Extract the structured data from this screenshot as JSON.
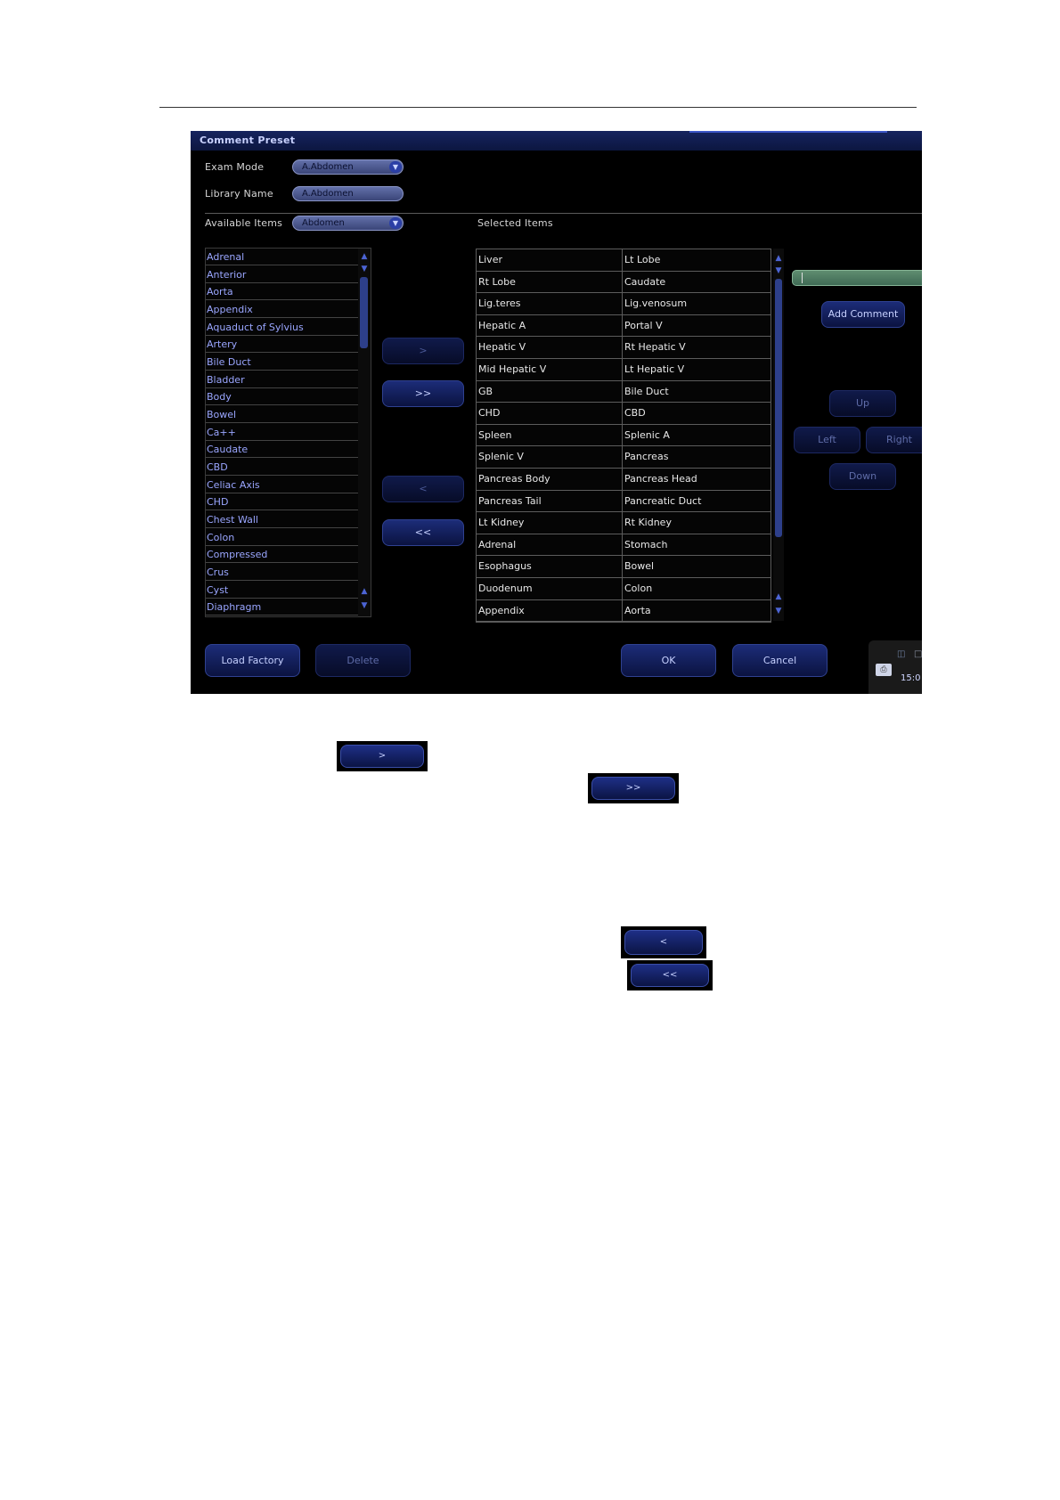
{
  "window": {
    "title": "Comment Preset"
  },
  "exam_mode": {
    "label": "Exam Mode",
    "value": "A.Abdomen"
  },
  "library_name": {
    "label": "Library Name",
    "value": "A.Abdomen"
  },
  "available": {
    "label": "Available Items",
    "filter": "Abdomen",
    "items": [
      "Adrenal",
      "Anterior",
      "Aorta",
      "Appendix",
      "Aquaduct of Sylvius",
      "Artery",
      "Bile Duct",
      "Bladder",
      "Body",
      "Bowel",
      "Ca++",
      "Caudate",
      "CBD",
      "Celiac Axis",
      "CHD",
      "Chest Wall",
      "Colon",
      "Compressed",
      "Crus",
      "Cyst",
      "Diaphragm"
    ]
  },
  "selected": {
    "label": "Selected Items",
    "rows": [
      [
        "Liver",
        "Lt Lobe"
      ],
      [
        "Rt Lobe",
        "Caudate"
      ],
      [
        "Lig.teres",
        "Lig.venosum"
      ],
      [
        "Hepatic A",
        "Portal V"
      ],
      [
        "Hepatic V",
        "Rt Hepatic V"
      ],
      [
        "Mid Hepatic V",
        "Lt Hepatic V"
      ],
      [
        "GB",
        "Bile Duct"
      ],
      [
        "CHD",
        "CBD"
      ],
      [
        "Spleen",
        "Splenic A"
      ],
      [
        "Splenic V",
        "Pancreas"
      ],
      [
        "Pancreas Body",
        "Pancreas Head"
      ],
      [
        "Pancreas Tail",
        "Pancreatic Duct"
      ],
      [
        "Lt Kidney",
        "Rt Kidney"
      ],
      [
        "Adrenal",
        "Stomach"
      ],
      [
        "Esophagus",
        "Bowel"
      ],
      [
        "Duodenum",
        "Colon"
      ],
      [
        "Appendix",
        "Aorta"
      ]
    ]
  },
  "transfer": {
    "add_one": ">",
    "add_all": ">>",
    "remove_one": "<",
    "remove_all": "<<"
  },
  "comment": {
    "add_label": "Add  Comment",
    "value": ""
  },
  "move": {
    "up": "Up",
    "left": "Left",
    "right": "Right",
    "down": "Down"
  },
  "footer": {
    "load_factory": "Load Factory",
    "delete": "Delete",
    "ok": "OK",
    "cancel": "Cancel"
  },
  "status": {
    "time": "15:0"
  },
  "icons": {
    "scroll_up": "triangle-up-icon",
    "scroll_down": "triangle-down-icon",
    "dropdown": "chevron-down-icon",
    "printer": "printer-icon"
  },
  "colors": {
    "available_text": "#9aa6ff",
    "accent": "#1c2c78",
    "input_green": "#5f8d70"
  }
}
